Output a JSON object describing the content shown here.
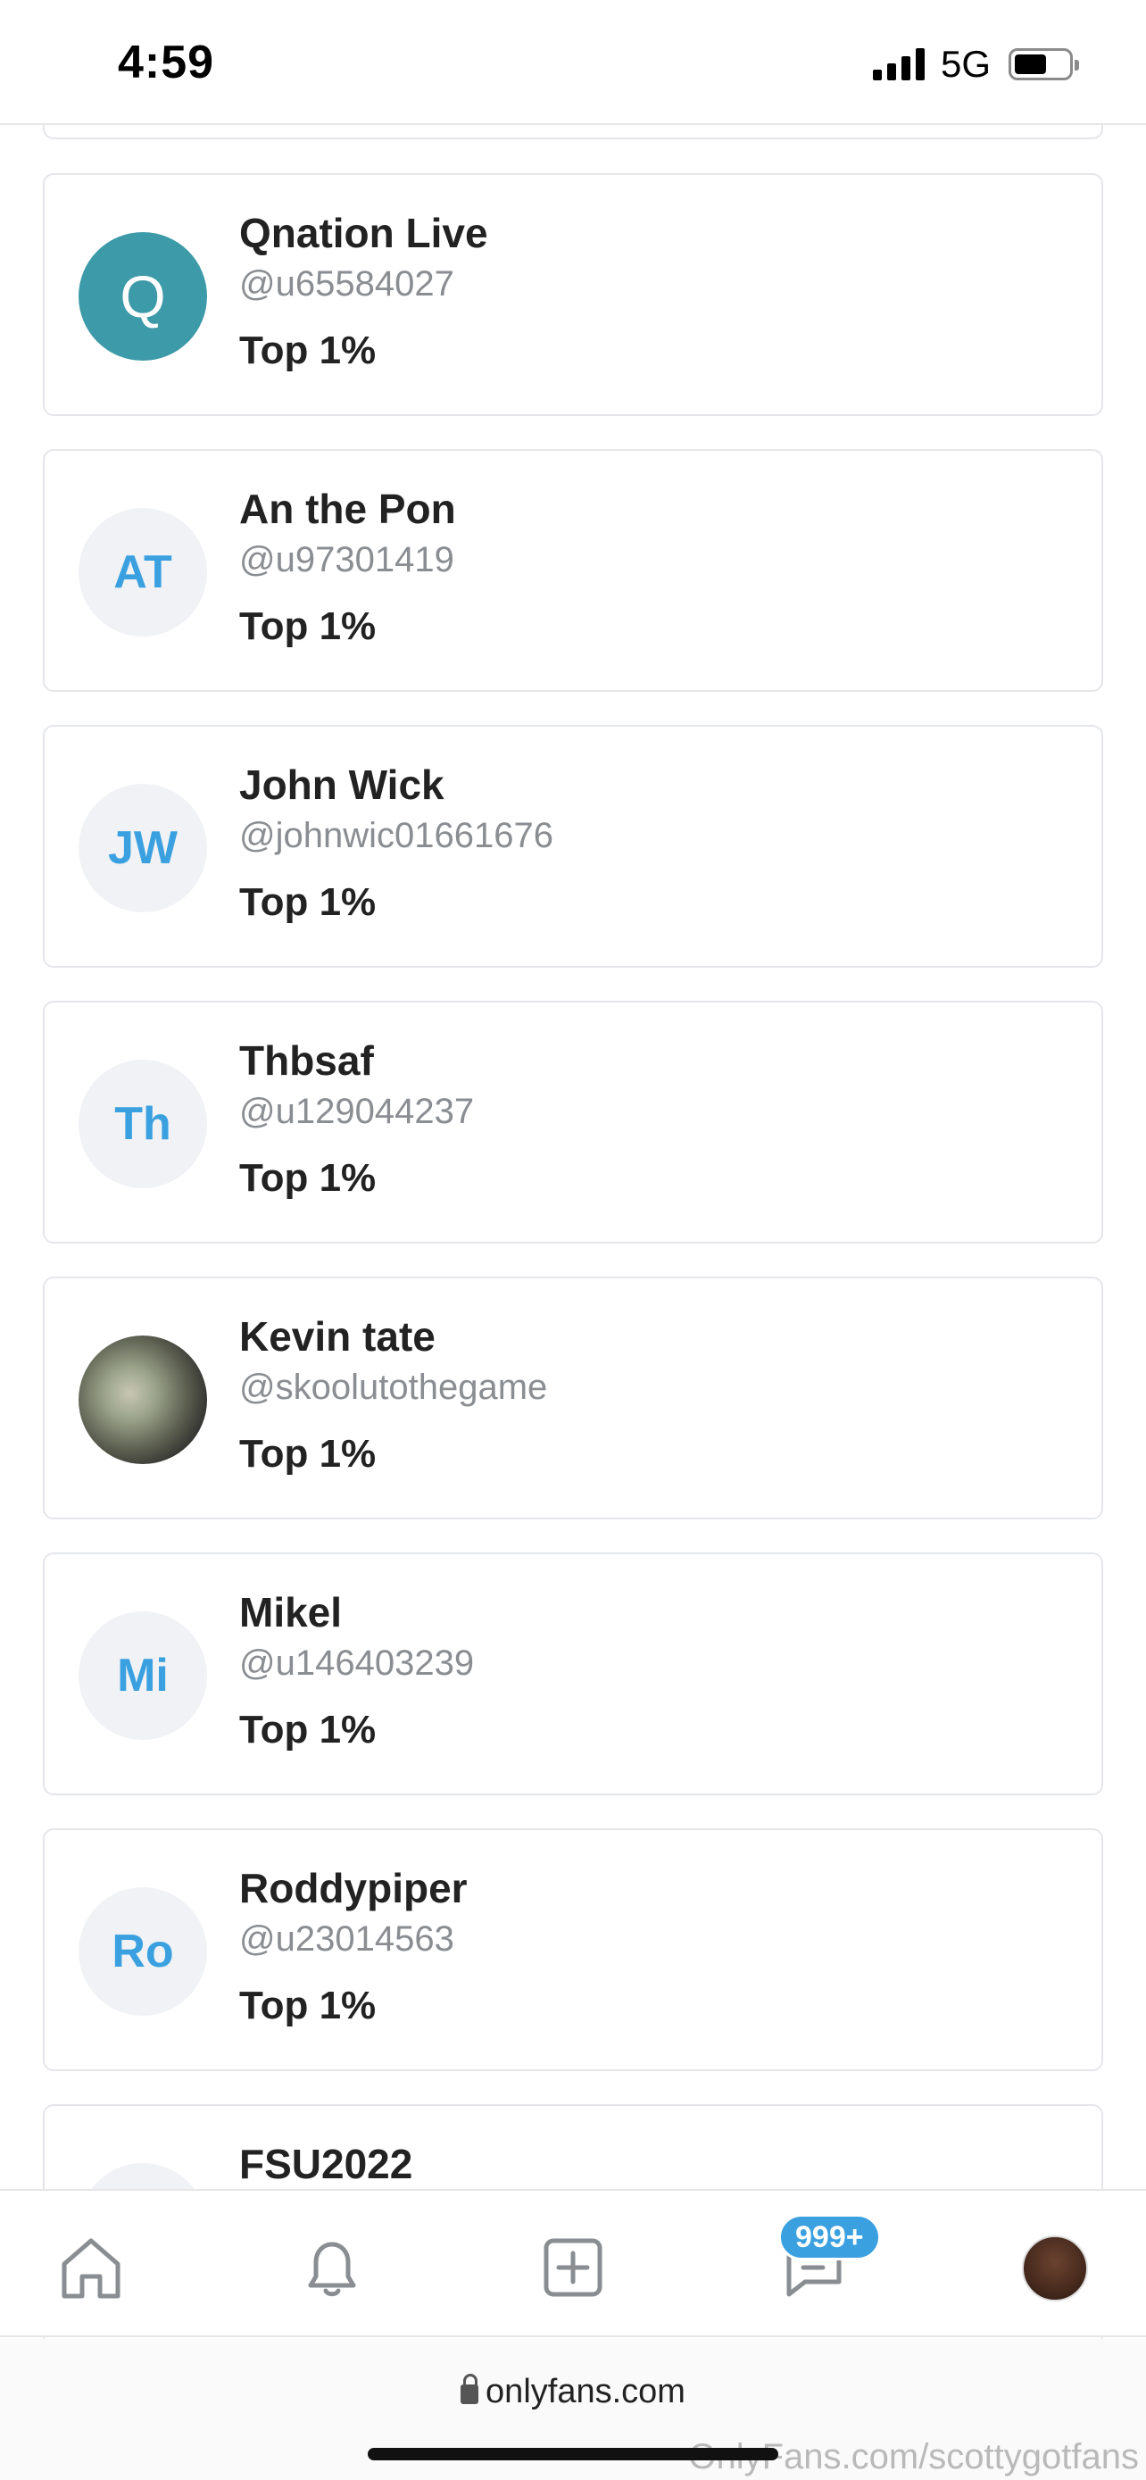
{
  "status_bar": {
    "time": "4:59",
    "network": "5G"
  },
  "users": [
    {
      "name": "Qnation Live",
      "handle": "@u65584027",
      "rank": "Top 1%",
      "avatar_text": "Q",
      "avatar_style": "teal"
    },
    {
      "name": "An the Pon",
      "handle": "@u97301419",
      "rank": "Top 1%",
      "avatar_text": "AT",
      "avatar_style": "initials"
    },
    {
      "name": "John Wick",
      "handle": "@johnwic01661676",
      "rank": "Top 1%",
      "avatar_text": "JW",
      "avatar_style": "initials"
    },
    {
      "name": "Thbsaf",
      "handle": "@u129044237",
      "rank": "Top 1%",
      "avatar_text": "Th",
      "avatar_style": "initials"
    },
    {
      "name": "Kevin tate",
      "handle": "@skoolutothegame",
      "rank": "Top 1%",
      "avatar_text": "",
      "avatar_style": "photo"
    },
    {
      "name": "Mikel",
      "handle": "@u146403239",
      "rank": "Top 1%",
      "avatar_text": "Mi",
      "avatar_style": "initials"
    },
    {
      "name": "Roddypiper",
      "handle": "@u23014563",
      "rank": "Top 1%",
      "avatar_text": "Ro",
      "avatar_style": "initials"
    },
    {
      "name": "FSU2022",
      "handle": "",
      "rank": "",
      "avatar_text": "",
      "avatar_style": "initials"
    }
  ],
  "bottom_nav": {
    "items": [
      "home-icon",
      "bell-icon",
      "add-post-icon",
      "messages-icon",
      "profile-avatar"
    ],
    "messages_badge": "999+"
  },
  "browser": {
    "url": "onlyfans.com",
    "watermark": "OnlyFans.com/scottygotfans"
  },
  "colors": {
    "accent": "#3aa0e0",
    "teal_avatar": "#3d9aa8",
    "card_border": "#e4e6ea",
    "handle_gray": "#8a8d91"
  }
}
